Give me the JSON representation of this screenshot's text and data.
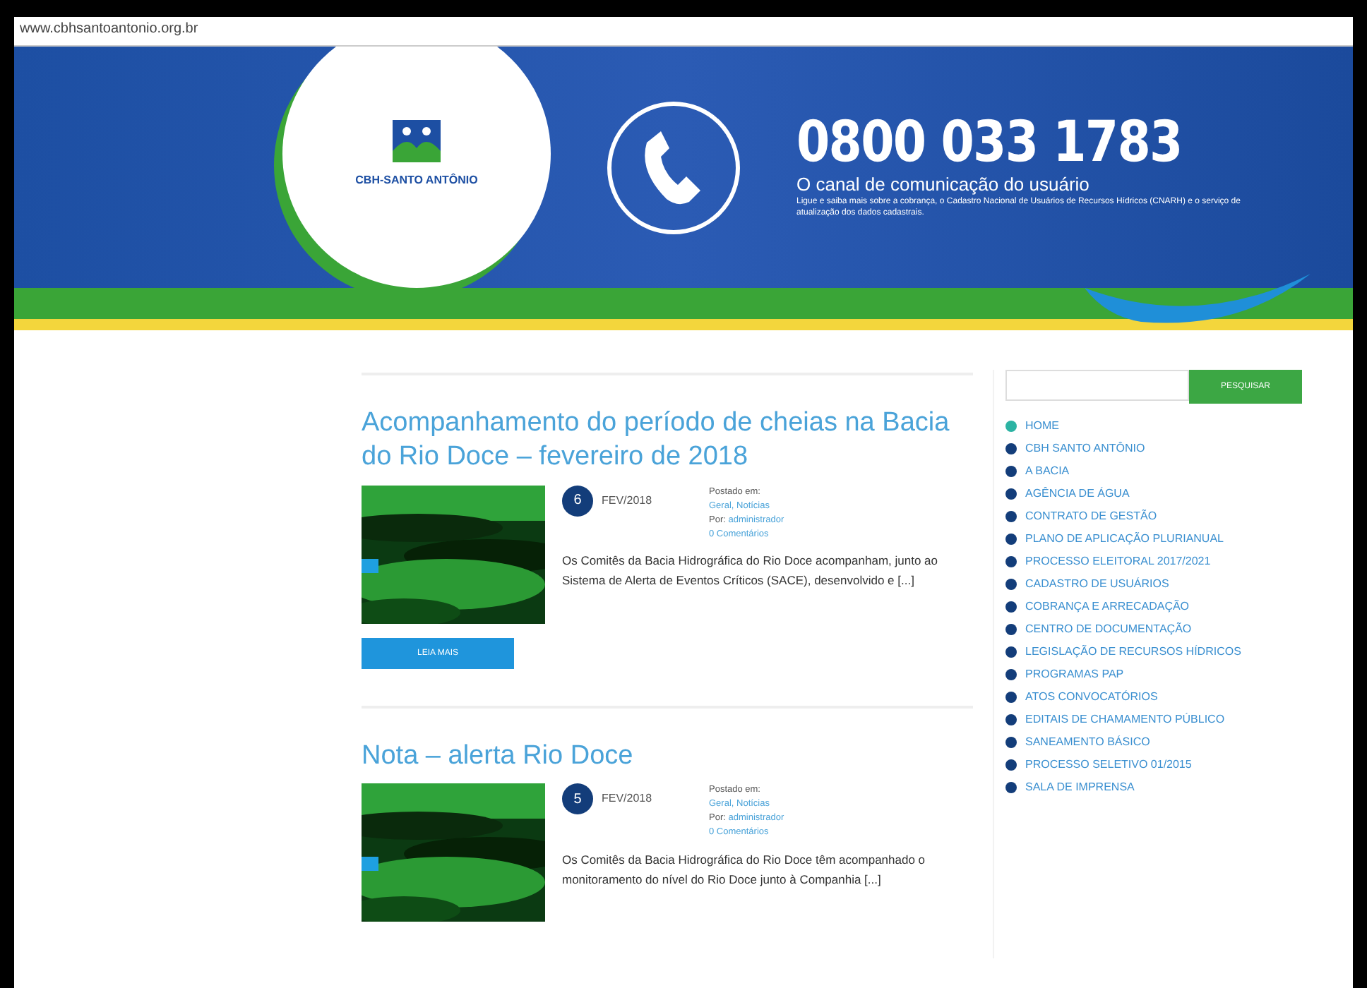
{
  "address_bar": {
    "url": "www.cbhsantoantonio.org.br"
  },
  "banner": {
    "logo_text": "CBH-SANTO ANTÔNIO",
    "phone": "0800 033 1783",
    "tagline": "O canal de comunicação do usuário",
    "description": "Ligue e saiba mais sobre a cobrança, o Cadastro Nacional de Usuários de Recursos Hídricos (CNARH) e o serviço de atualização dos dados cadastrais."
  },
  "posts": [
    {
      "title": "Acompanhamento do período de cheias na Bacia do Rio Doce – fevereiro de 2018",
      "day": "6",
      "month": "FEV/2018",
      "posted_label": "Postado em:",
      "category": "Geral, Notícias",
      "by_label": "Por:",
      "author": "administrador",
      "comments": "0 Comentários",
      "excerpt": "Os Comitês da Bacia Hidrográfica do Rio Doce acompanham, junto ao Sistema de Alerta de Eventos Críticos (SACE), desenvolvido e [...]",
      "button": "LEIA MAIS"
    },
    {
      "title": "Nota – alerta Rio Doce",
      "day": "5",
      "month": "FEV/2018",
      "posted_label": "Postado em:",
      "category": "Geral, Notícias",
      "by_label": "Por:",
      "author": "administrador",
      "comments": "0 Comentários",
      "excerpt": "Os Comitês da Bacia Hidrográfica do Rio Doce têm acompanhado o monitoramento do nível do Rio Doce junto à Companhia [...]"
    }
  ],
  "sidebar": {
    "search_button": "PESQUISAR",
    "menu": [
      {
        "label": "HOME",
        "selected": true
      },
      {
        "label": "CBH SANTO ANTÔNIO",
        "selected": false
      },
      {
        "label": "A BACIA",
        "selected": false
      },
      {
        "label": "AGÊNCIA DE ÁGUA",
        "selected": false
      },
      {
        "label": "CONTRATO DE GESTÃO",
        "selected": false
      },
      {
        "label": "PLANO DE APLICAÇÃO PLURIANUAL",
        "selected": false
      },
      {
        "label": "PROCESSO ELEITORAL 2017/2021",
        "selected": false
      },
      {
        "label": "CADASTRO DE USUÁRIOS",
        "selected": false
      },
      {
        "label": "COBRANÇA E ARRECADAÇÃO",
        "selected": false
      },
      {
        "label": "CENTRO DE DOCUMENTAÇÃO",
        "selected": false
      },
      {
        "label": "LEGISLAÇÃO DE RECURSOS HÍDRICOS",
        "selected": false
      },
      {
        "label": "PROGRAMAS PAP",
        "selected": false
      },
      {
        "label": "ATOS CONVOCATÓRIOS",
        "selected": false
      },
      {
        "label": "EDITAIS DE CHAMAMENTO PÚBLICO",
        "selected": false
      },
      {
        "label": "SANEAMENTO BÁSICO",
        "selected": false
      },
      {
        "label": "PROCESSO SELETIVO 01/2015",
        "selected": false
      },
      {
        "label": "SALA DE IMPRENSA",
        "selected": false
      }
    ]
  }
}
